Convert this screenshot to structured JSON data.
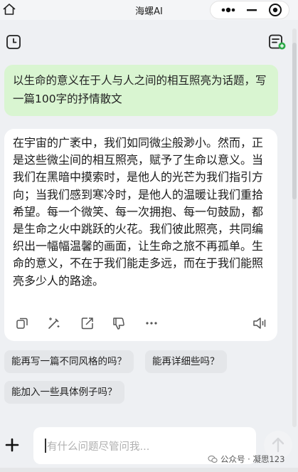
{
  "header": {
    "title": "海螺AI"
  },
  "conversation": {
    "user_message": "以生命的意义在于人与人之间的相互照亮为话题，写一篇100字的抒情散文",
    "assistant_reply": "在宇宙的广袤中，我们如同微尘般渺小。然而，正是这些微尘间的相互照亮，赋予了生命以意义。当我们在黑暗中摸索时，是他人的光芒为我们指引方向；当我们感到寒冷时，是他人的温暖让我们重拾希望。每一个微笑、每一次拥抱、每一句鼓励，都是生命之火中跳跃的火花。我们彼此照亮，共同编织出一幅幅温馨的画面，让生命之旅不再孤单。生命的意义，不在于我们能走多远，而在于我们能照亮多少人的路途。"
  },
  "suggestions": [
    "能再写一篇不同风格的吗？",
    "能再详细些吗？",
    "能加入一些具体例子吗？"
  ],
  "input": {
    "placeholder": "有什么问题尽管问我..."
  },
  "watermark": {
    "label": "公众号 · 凝思123"
  },
  "icons": {
    "home": "home-icon",
    "more": "more-dots-icon",
    "minimize": "minimize-icon",
    "close": "close-circle-icon",
    "history": "history-clock-icon",
    "new_chat": "new-chat-icon",
    "copy": "copy-icon",
    "rewrite": "magic-wand-icon",
    "share": "share-icon",
    "dislike": "thumbs-down-icon",
    "more_actions": "more-dots-icon",
    "speaker": "speaker-icon",
    "plus": "plus-icon",
    "send": "send-arrow-icon"
  },
  "colors": {
    "user_bubble": "#d9f5d1",
    "background": "#eef0f3",
    "card": "#ffffff"
  }
}
